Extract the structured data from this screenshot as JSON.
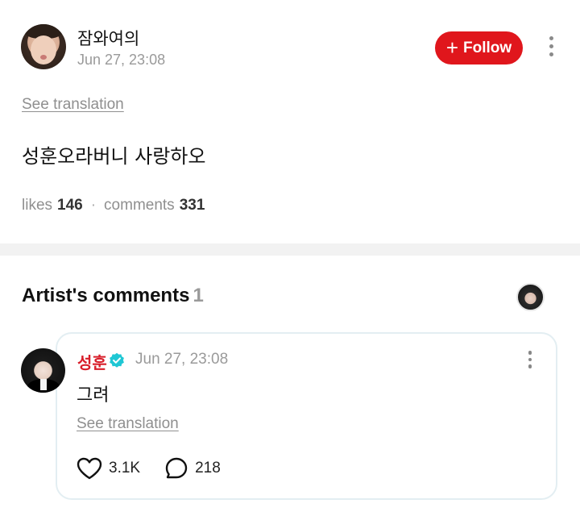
{
  "post": {
    "author": "잠와여의",
    "timestamp": "Jun 27, 23:08",
    "follow_label": "Follow",
    "see_translation": "See translation",
    "text": "성훈오라버니 사랑하오",
    "likes_label": "likes",
    "likes_count": "146",
    "comments_label": "comments",
    "comments_count": "331",
    "separator": "·"
  },
  "artist_comments": {
    "title": "Artist's comments",
    "count": "1",
    "comment": {
      "author": "성훈",
      "timestamp": "Jun 27, 23:08",
      "text": "그려",
      "see_translation": "See translation",
      "likes": "3.1K",
      "replies": "218"
    }
  },
  "colors": {
    "follow_button": "#e0161c",
    "artist_name": "#d81e2a",
    "verified_badge": "#1fc7d4",
    "muted_text": "#8f8f8f"
  },
  "icons": [
    "plus-icon",
    "more-vertical-icon",
    "verified-badge-icon",
    "heart-icon",
    "comment-bubble-icon"
  ]
}
